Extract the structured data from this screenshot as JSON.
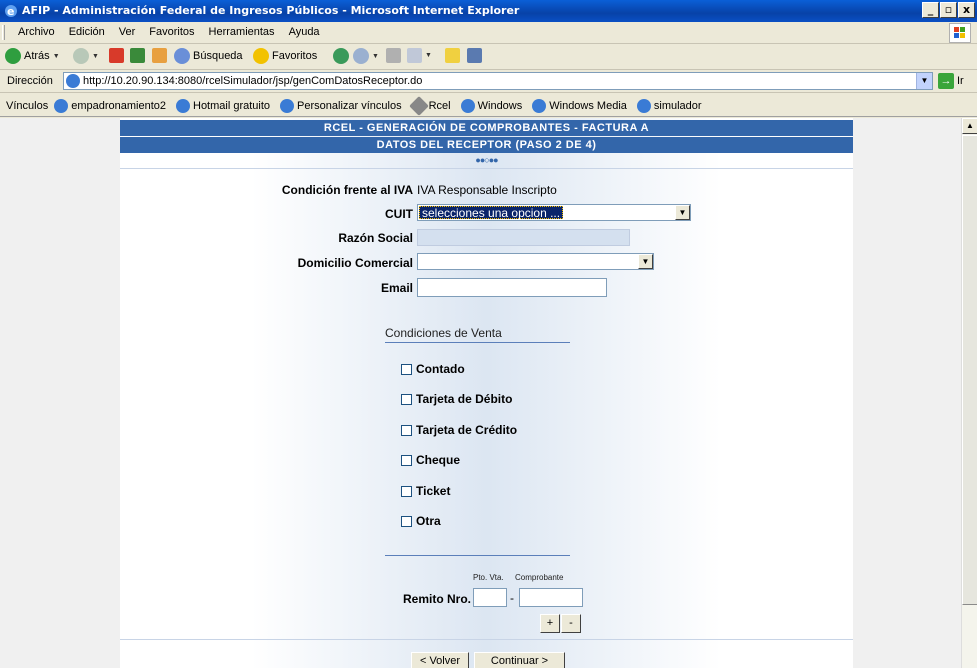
{
  "window": {
    "title": "AFIP - Administración Federal de Ingresos Públicos - Microsoft Internet Explorer",
    "controls": [
      "_",
      "8",
      "x"
    ]
  },
  "menu": [
    "Archivo",
    "Edición",
    "Ver",
    "Favoritos",
    "Herramientas",
    "Ayuda"
  ],
  "toolbar": {
    "back": "Atrás",
    "search": "Búsqueda",
    "favorites": "Favoritos"
  },
  "address": {
    "label": "Dirección",
    "url": "http://10.20.90.134:8080/rcelSimulador/jsp/genComDatosReceptor.do",
    "go": "Ir"
  },
  "links": {
    "label": "Vínculos",
    "items": [
      "empadronamiento2",
      "Hotmail gratuito",
      "Personalizar vínculos",
      "Rcel",
      "Windows",
      "Windows Media",
      "simulador"
    ]
  },
  "page": {
    "header": "RCEL - GENERACIÓN DE COMPROBANTES - FACTURA A",
    "subheader": "DATOS DEL RECEPTOR (PASO 2 DE 4)",
    "steps": "●●○●●",
    "iva_label": "Condición frente al IVA",
    "iva_value": "IVA Responsable Inscripto",
    "cuit_label": "CUIT",
    "cuit_value": "selecciones una opcion ...",
    "razon_label": "Razón Social",
    "domicilio_label": "Domicilio Comercial",
    "email_label": "Email",
    "conditions_title": "Condiciones de Venta",
    "conditions": [
      "Contado",
      "Tarjeta de Débito",
      "Tarjeta de Crédito",
      "Cheque",
      "Ticket",
      "Otra"
    ],
    "pto_vta_label": "Pto. Vta.",
    "comprobante_label": "Comprobante",
    "remito_label": "Remito Nro.",
    "add_label": "+",
    "remove_label": "-",
    "back_label": "< Volver",
    "continue_label": "Continuar >"
  }
}
